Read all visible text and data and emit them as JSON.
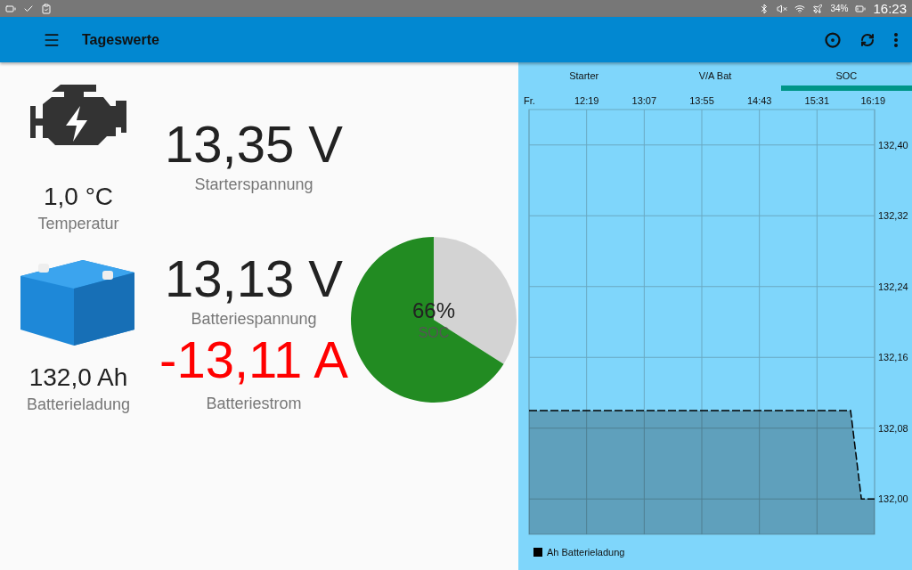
{
  "status_bar": {
    "battery": "34%",
    "time": "16:23"
  },
  "app_bar": {
    "title": "Tageswerte"
  },
  "side_readings": [
    {
      "kind": "engine",
      "value": "1,0 °C",
      "label": "Temperatur"
    },
    {
      "kind": "battery",
      "value": "132,0 Ah",
      "label": "Batterieladung"
    }
  ],
  "main_readings": [
    {
      "value": "13,35 V",
      "label": "Starterspannung",
      "alert": false
    },
    {
      "value": "13,13 V",
      "label": "Batteriespannung",
      "alert": false
    },
    {
      "value": "-13,11 A",
      "label": "Batteriestrom",
      "alert": true
    }
  ],
  "gauge": {
    "value": "66%",
    "label": "SOC",
    "chart_data": {
      "type": "pie",
      "values": [
        66,
        34
      ]
    }
  },
  "tabs": [
    {
      "label": "Starter",
      "selected": false
    },
    {
      "label": "V/A Bat",
      "selected": false
    },
    {
      "label": "SOC",
      "selected": true
    }
  ],
  "chart": {
    "chart_data": {
      "type": "area",
      "grid": true,
      "x": [
        691,
        959,
        968,
        979
      ],
      "series": [
        {
          "name": "Ah Batterieladung",
          "color": "#000000",
          "values": [
            132.1,
            132.1,
            132.0,
            132.0
          ]
        }
      ],
      "xlim": [
        691,
        979
      ],
      "ylim": [
        131.96,
        132.44
      ],
      "xticks": [
        {
          "value": 691,
          "label": "Fr."
        },
        {
          "value": 739,
          "label": "12:19"
        },
        {
          "value": 787,
          "label": "13:07"
        },
        {
          "value": 835,
          "label": "13:55"
        },
        {
          "value": 883,
          "label": "14:43"
        },
        {
          "value": 931,
          "label": "15:31"
        },
        {
          "value": 979,
          "label": "16:19"
        }
      ],
      "yticks": [
        {
          "value": 132.4,
          "label": "132,40"
        },
        {
          "value": 132.32,
          "label": "132,32"
        },
        {
          "value": 132.24,
          "label": "132,24"
        },
        {
          "value": 132.16,
          "label": "132,16"
        },
        {
          "value": 132.08,
          "label": "132,08"
        },
        {
          "value": 132.0,
          "label": "132,00"
        }
      ]
    }
  }
}
